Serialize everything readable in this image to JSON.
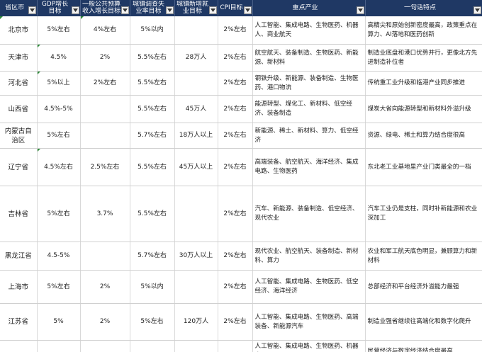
{
  "headers": [
    "省区市",
    "GDP增长目标",
    "一般公共预算收入增长目标",
    "城镇调查失业率目标",
    "城镇新增就业目标",
    "CPI目标",
    "重点产业",
    "一句话特点"
  ],
  "rows": [
    {
      "province": "北京市",
      "gdp": "5%左右",
      "revenue": "4%左右",
      "unemp": "5%以内",
      "jobs": "",
      "cpi": "2%左右",
      "industry": "人工智能、集成电路、生物医药、机器人、商业航天",
      "note": "高精尖和原始创新密度最高，政策重点在算力、AI落地和医药创新"
    },
    {
      "province": "天津市",
      "gdp": "4.5%",
      "revenue": "2%",
      "unemp": "5.5%左右",
      "jobs": "28万人",
      "cpi": "2%左右",
      "industry": "航空航天、装备制造、生物医药、新能源、新材料",
      "note": "制造业底盘和港口优势并行，更像北方先进制造补位者"
    },
    {
      "province": "河北省",
      "gdp": "5%以上",
      "revenue": "2%左右",
      "unemp": "5.5%左右",
      "jobs": "",
      "cpi": "2%左右",
      "industry": "钢铁升级、新能源、装备制造、生物医药、港口物流",
      "note": "传统重工业升级和临港产业同步推进"
    },
    {
      "province": "山西省",
      "gdp": "4.5%-5%",
      "revenue": "",
      "unemp": "5.5%左右",
      "jobs": "45万人",
      "cpi": "2%左右",
      "industry": "能源转型、煤化工、新材料、低空经济、装备制造",
      "note": "煤炭大省向能源转型和新材料外溢升级"
    },
    {
      "province": "内蒙古自治区",
      "gdp": "5%左右",
      "revenue": "",
      "unemp": "5.7%左右",
      "jobs": "18万人以上",
      "cpi": "2%左右",
      "industry": "新能源、稀土、新材料、算力、低空经济",
      "note": "资源、绿电、稀土和算力结合度很高"
    },
    {
      "province": "辽宁省",
      "gdp": "4.5%左右",
      "revenue": "2.5%左右",
      "unemp": "5.5%左右",
      "jobs": "45万人以上",
      "cpi": "2%左右",
      "industry": "高端装备、航空航天、海洋经济、集成电路、生物医药",
      "note": "东北老工业基地里产业门类最全的一档"
    },
    {
      "province": "吉林省",
      "gdp": "5%左右",
      "revenue": "3.7%",
      "unemp": "5.5%左右",
      "jobs": "",
      "cpi": "2%左右",
      "industry": "汽车、新能源、装备制造、低空经济、现代农业",
      "note": "汽车工业仍是支柱，同时补新能源和农业深加工"
    },
    {
      "province": "黑龙江省",
      "gdp": "4.5-5%",
      "revenue": "",
      "unemp": "5.7%左右",
      "jobs": "30万人以上",
      "cpi": "2%左右",
      "industry": "现代农业、航空航天、装备制造、新材料、算力",
      "note": "农业和军工航天底色明显，兼顾算力和新材料"
    },
    {
      "province": "上海市",
      "gdp": "5%左右",
      "revenue": "2%",
      "unemp": "5%以内",
      "jobs": "",
      "cpi": "2%左右",
      "industry": "人工智能、集成电路、生物医药、低空经济、海洋经济",
      "note": "总部经济和平台经济外溢能力最强"
    },
    {
      "province": "江苏省",
      "gdp": "5%",
      "revenue": "2%",
      "unemp": "5%左右",
      "jobs": "120万人",
      "cpi": "2%左右",
      "industry": "人工智能、集成电路、生物医药、高端装备、新能源汽车",
      "note": "制造业强省继续往高端化和数字化爬升"
    },
    {
      "province": "",
      "gdp": "",
      "revenue": "",
      "unemp": "",
      "jobs": "",
      "cpi": "",
      "industry": "人工智能、集成电路、生物医药、机器人",
      "note": "民营经济与数字经济结合度最高"
    }
  ],
  "colors": {
    "header_bg": "#1f3864",
    "header_text": "#ffffff",
    "grid": "#d9d9d9",
    "comment_marker": "#2e8b3a"
  }
}
